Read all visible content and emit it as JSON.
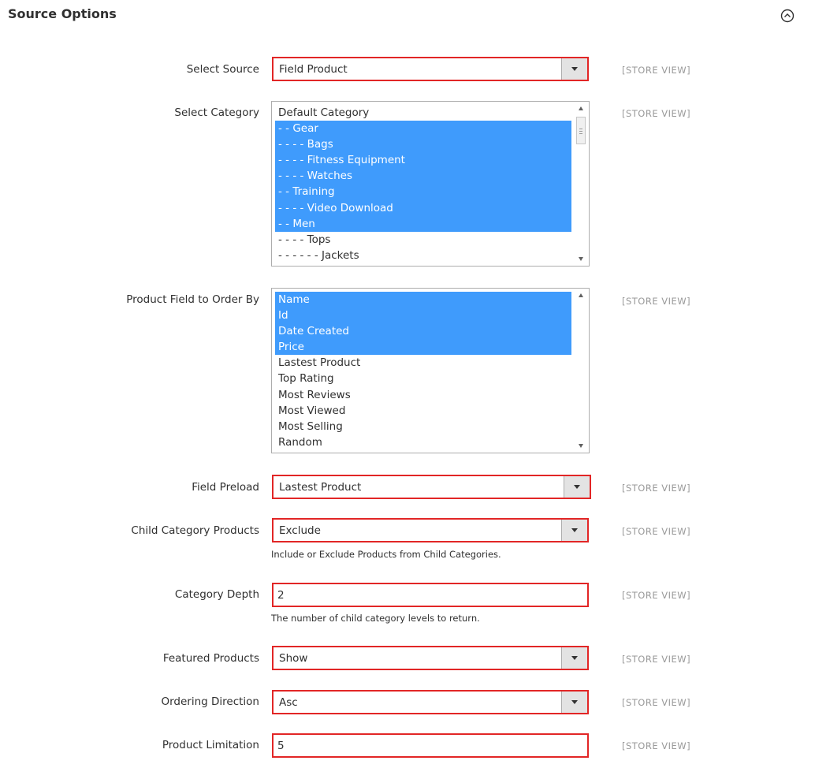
{
  "section": {
    "title": "Source Options",
    "icon": "chevron-up-circle-icon"
  },
  "scope_label": "[STORE VIEW]",
  "fields": {
    "select_source": {
      "label": "Select Source",
      "value": "Field Product"
    },
    "select_category": {
      "label": "Select Category",
      "options": [
        {
          "text": "Default Category",
          "selected": false
        },
        {
          "text": "- - Gear",
          "selected": true
        },
        {
          "text": "- - - - Bags",
          "selected": true
        },
        {
          "text": "- - - - Fitness Equipment",
          "selected": true
        },
        {
          "text": "- - - - Watches",
          "selected": true
        },
        {
          "text": "- - Training",
          "selected": true
        },
        {
          "text": "- - - - Video Download",
          "selected": true
        },
        {
          "text": "- - Men",
          "selected": true
        },
        {
          "text": "- - - - Tops",
          "selected": false
        },
        {
          "text": "- - - - - - Jackets",
          "selected": false
        }
      ]
    },
    "order_by": {
      "label": "Product Field to Order By",
      "options": [
        {
          "text": "Name",
          "selected": true
        },
        {
          "text": "Id",
          "selected": true
        },
        {
          "text": "Date Created",
          "selected": true
        },
        {
          "text": "Price",
          "selected": true
        },
        {
          "text": "Lastest Product",
          "selected": false
        },
        {
          "text": "Top Rating",
          "selected": false
        },
        {
          "text": "Most Reviews",
          "selected": false
        },
        {
          "text": "Most Viewed",
          "selected": false
        },
        {
          "text": "Most Selling",
          "selected": false
        },
        {
          "text": "Random",
          "selected": false
        }
      ]
    },
    "field_preload": {
      "label": "Field Preload",
      "value": "Lastest Product"
    },
    "child_category": {
      "label": "Child Category Products",
      "value": "Exclude",
      "note": "Include or Exclude Products from Child Categories."
    },
    "category_depth": {
      "label": "Category Depth",
      "value": "2",
      "note": "The number of child category levels to return."
    },
    "featured_products": {
      "label": "Featured Products",
      "value": "Show"
    },
    "ordering_direction": {
      "label": "Ordering Direction",
      "value": "Asc"
    },
    "product_limitation": {
      "label": "Product Limitation",
      "value": "5"
    }
  },
  "colors": {
    "highlight": "#3f9bfc",
    "error_border": "#e22626",
    "scope_text": "#999999"
  }
}
